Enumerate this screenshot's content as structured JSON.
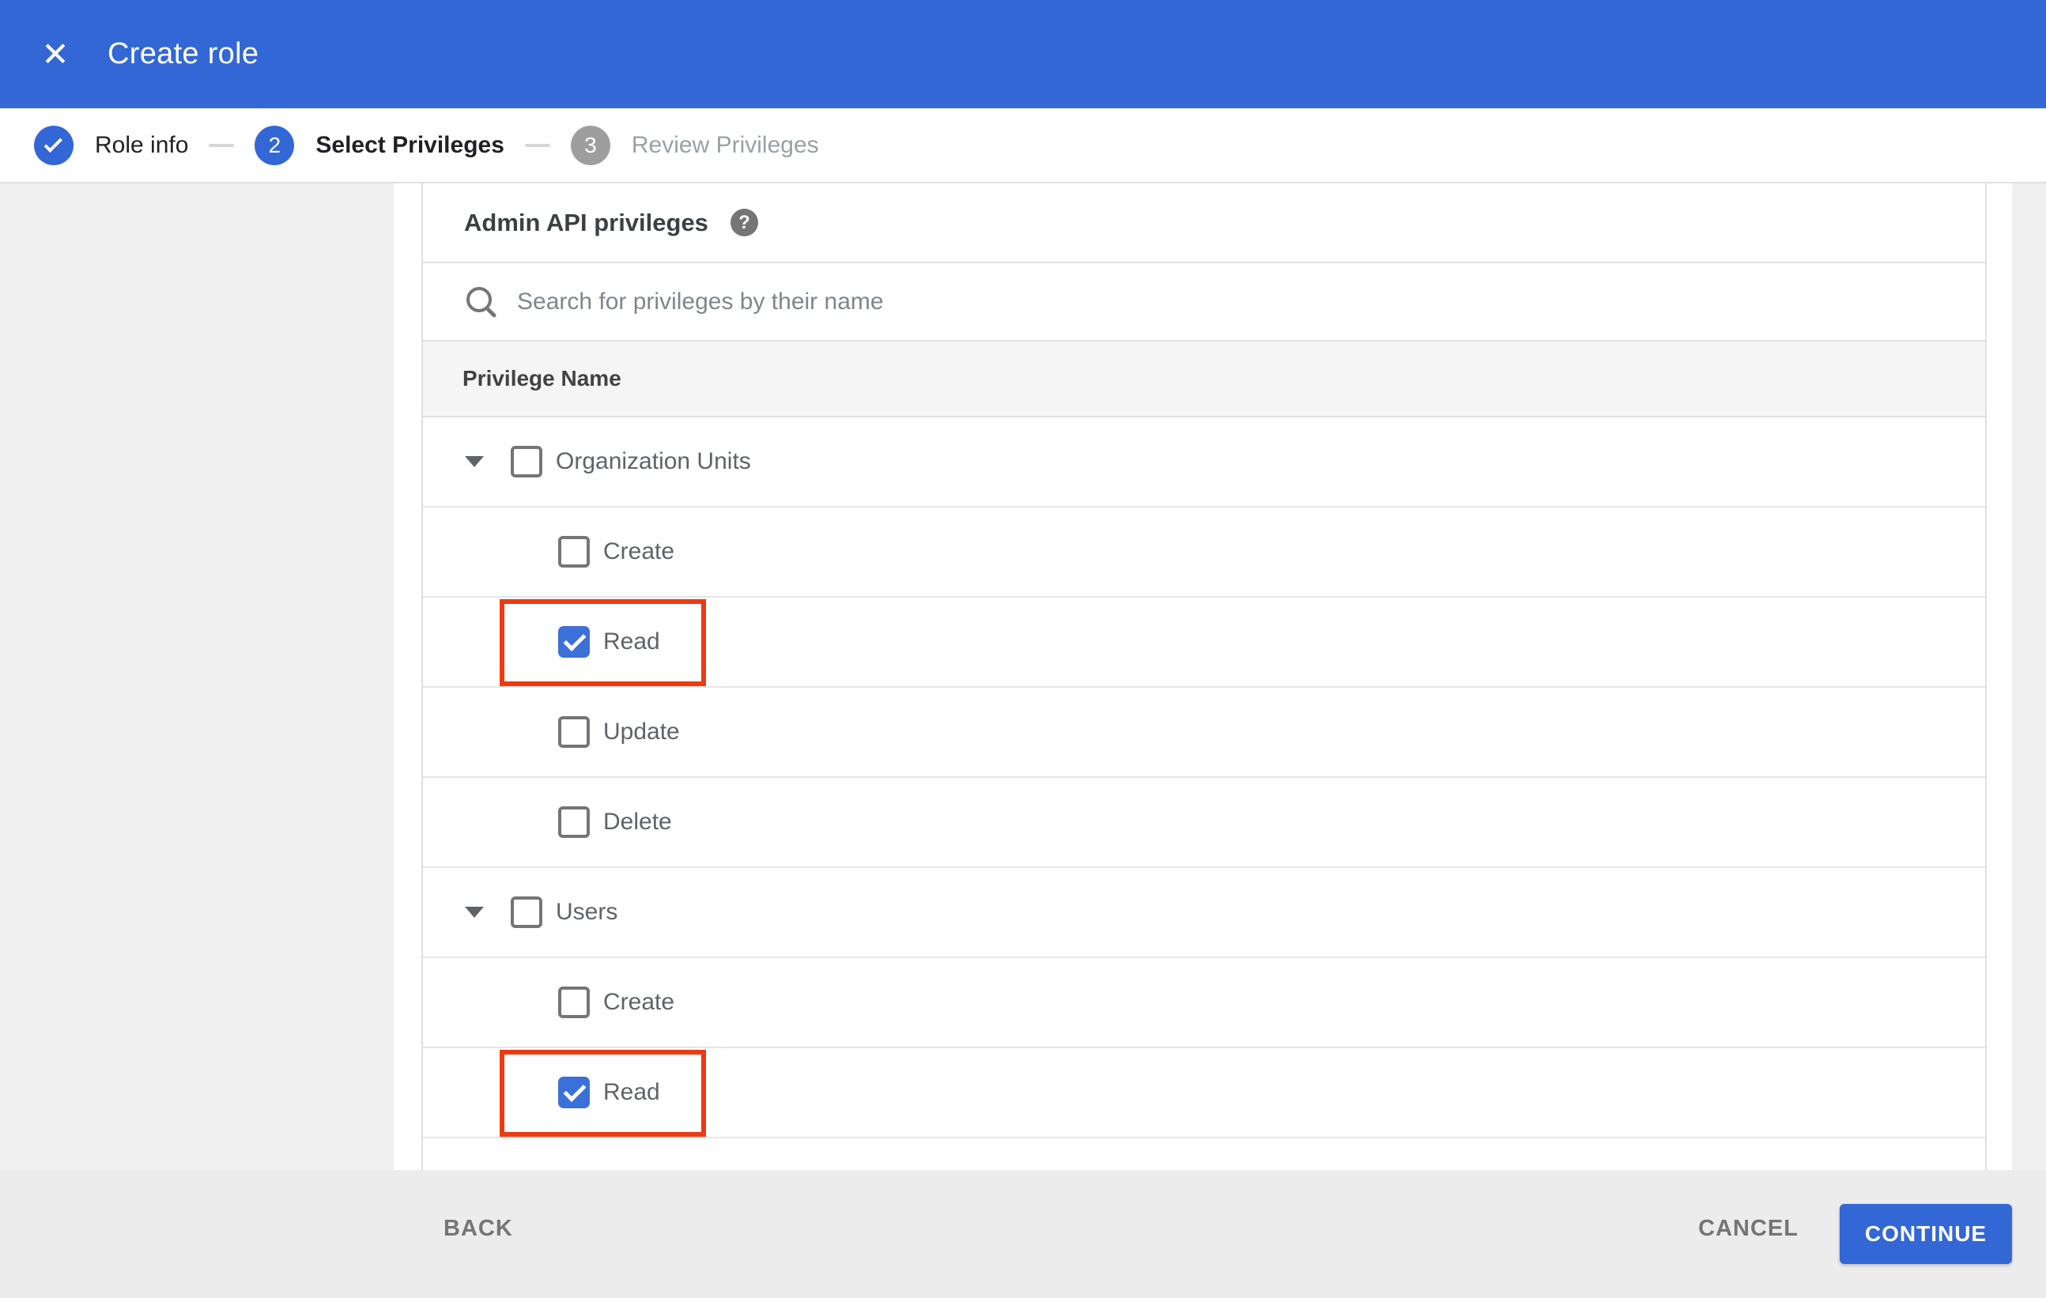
{
  "header": {
    "title": "Create role",
    "close_glyph": "✕"
  },
  "stepper": {
    "steps": [
      {
        "number": "1",
        "label": "Role info",
        "state": "completed"
      },
      {
        "number": "2",
        "label": "Select Privileges",
        "state": "active"
      },
      {
        "number": "3",
        "label": "Review Privileges",
        "state": "upcoming"
      }
    ]
  },
  "panel": {
    "title": "Admin API privileges",
    "help_glyph": "?",
    "search": {
      "value": "",
      "placeholder": "Search for privileges by their name"
    },
    "table": {
      "header": "Privilege Name",
      "rows": [
        {
          "type": "parent",
          "label": "Organization Units",
          "checked": false,
          "highlighted": false
        },
        {
          "type": "child",
          "label": "Create",
          "checked": false,
          "highlighted": false
        },
        {
          "type": "child",
          "label": "Read",
          "checked": true,
          "highlighted": true
        },
        {
          "type": "child",
          "label": "Update",
          "checked": false,
          "highlighted": false
        },
        {
          "type": "child",
          "label": "Delete",
          "checked": false,
          "highlighted": false
        },
        {
          "type": "parent",
          "label": "Users",
          "checked": false,
          "highlighted": false
        },
        {
          "type": "child",
          "label": "Create",
          "checked": false,
          "highlighted": false
        },
        {
          "type": "child",
          "label": "Read",
          "checked": true,
          "highlighted": true
        }
      ]
    }
  },
  "footer": {
    "back_label": "BACK",
    "cancel_label": "CANCEL",
    "continue_label": "CONTINUE"
  },
  "colors": {
    "accent_blue": "#3367d6",
    "checkbox_blue": "#3c70d9",
    "highlight_red": "#ee3a11",
    "page_gray": "#f0f0f0",
    "footer_gray": "#ececec",
    "table_header_gray": "#f5f5f5"
  }
}
